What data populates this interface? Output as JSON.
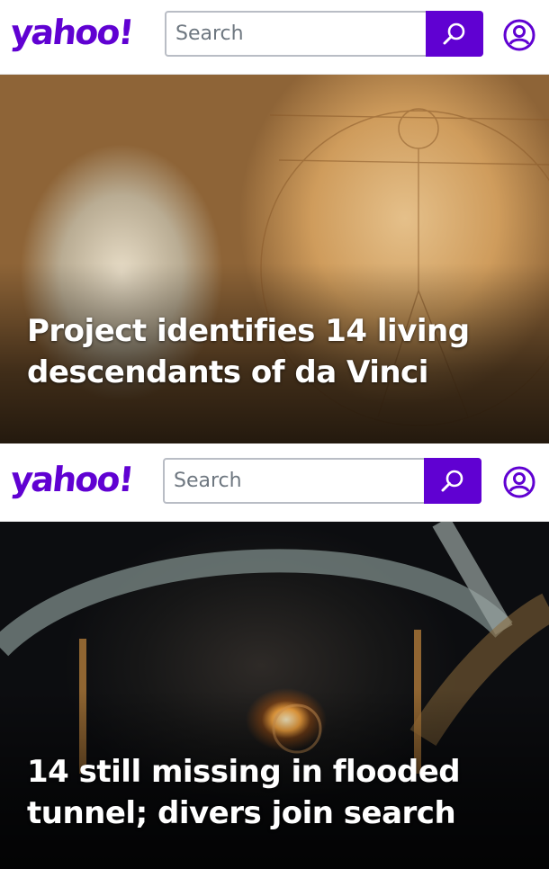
{
  "brand": {
    "logo_text": "yahoo!",
    "accent": "#6001d2"
  },
  "search": {
    "placeholder": "Search"
  },
  "icons": {
    "search": "search-icon",
    "profile": "profile-icon"
  },
  "stories": [
    {
      "headline": "Project identifies 14 living descendants of da Vinci"
    },
    {
      "headline": "14 still missing in flooded tunnel; divers join search"
    }
  ]
}
